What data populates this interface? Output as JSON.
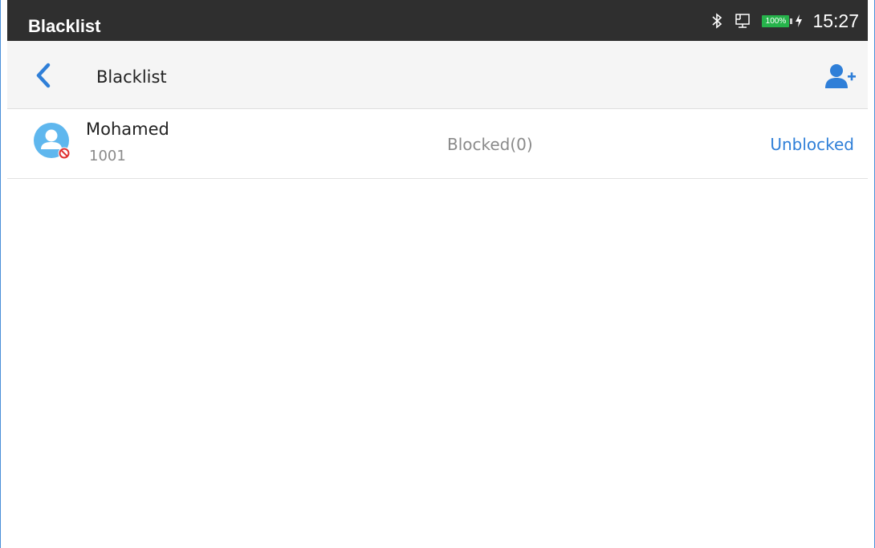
{
  "statusbar": {
    "app_title": "Blacklist",
    "battery_level": "100%",
    "time": "15:27",
    "icons": [
      "bluetooth-icon",
      "network-icon",
      "battery-icon",
      "charging-icon"
    ],
    "battery_color": "#26b34b"
  },
  "toolbar": {
    "title": "Blacklist",
    "back_icon": "chevron-left-icon",
    "add_icon": "add-contact-icon",
    "accent": "#2f7fd8"
  },
  "blacklist": {
    "items": [
      {
        "name": "Mohamed",
        "number": "1001",
        "blocked_label": "Blocked(0)",
        "action_label": "Unblocked",
        "avatar_icon": "contact-avatar-icon",
        "badge_icon": "blocked-icon"
      }
    ]
  }
}
